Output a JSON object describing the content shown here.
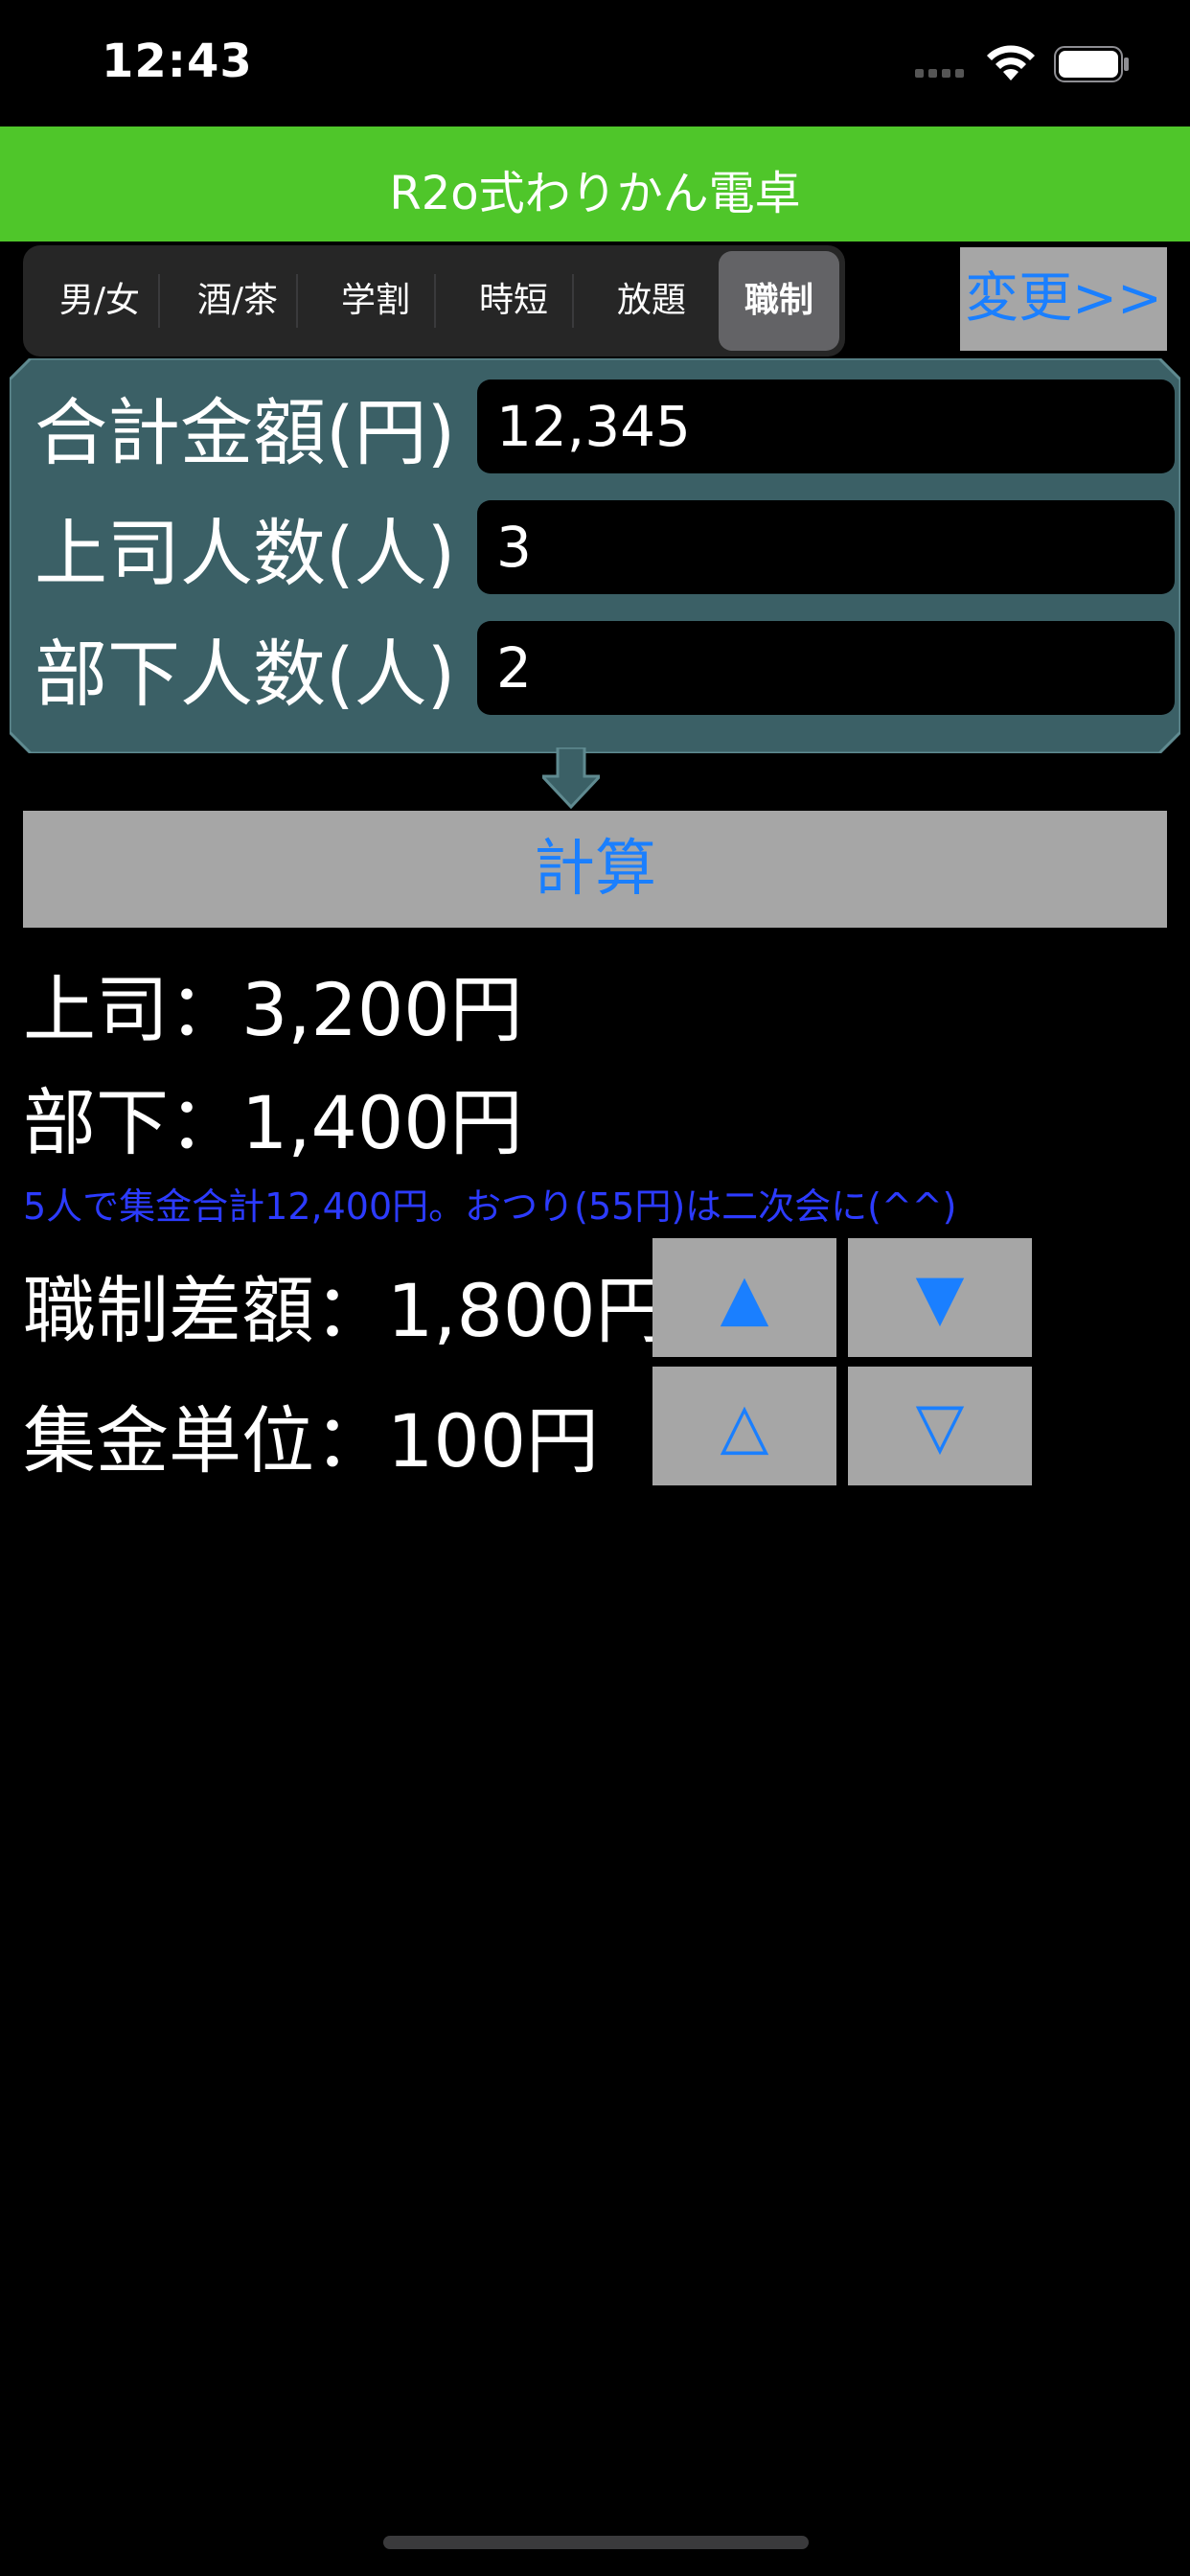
{
  "status": {
    "time": "12:43"
  },
  "nav": {
    "title": "R2o式わりかん電卓"
  },
  "segments": [
    "男/女",
    "酒/茶",
    "学割",
    "時短",
    "放題",
    "職制"
  ],
  "selected_segment": "職制",
  "change_button": "変更>>",
  "fields": [
    {
      "label": "合計金額(円)",
      "value": "12,345"
    },
    {
      "label": "上司人数(人)",
      "value": "3"
    },
    {
      "label": "部下人数(人)",
      "value": "2"
    }
  ],
  "calc_button": "計算",
  "results": {
    "boss": "上司：3,200円",
    "subordinate": "部下：1,400円",
    "note": "5人で集金合計12,400円。おつり(55円)は二次会に(^^)",
    "difference": "職制差額：1,800円",
    "unit": "集金単位：100円"
  },
  "steppers": {
    "difference_up": "▲",
    "difference_down": "▼",
    "unit_up": "△",
    "unit_down": "▽"
  },
  "colors": {
    "nav": "#4fc62a",
    "accent": "#1a7fff",
    "panel": "#3b6066",
    "note": "#2c3bff",
    "button": "#a6a6a6"
  }
}
